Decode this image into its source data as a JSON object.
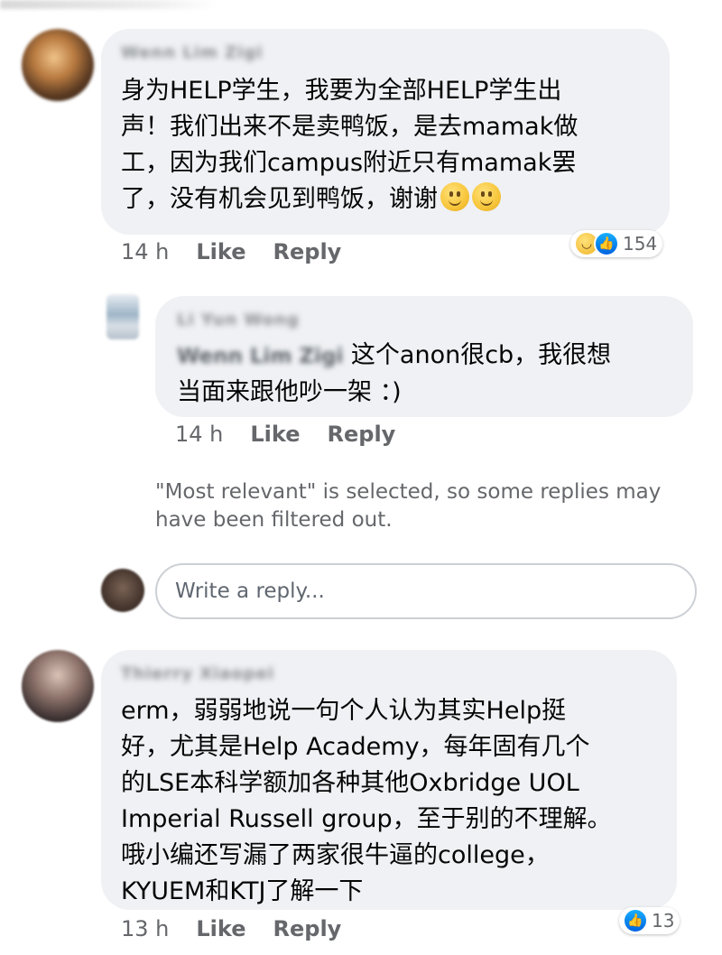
{
  "comments": [
    {
      "author": "Wenn Lim Zigi",
      "text": "身为HELP学生，我要为全部HELP学生出\n声！我们出来不是卖鸭饭，是去mamak做\n工，因为我们campus附近只有mamak罢\n了，没有机会见到鸭饭，谢谢",
      "emoji": [
        "slightly-smiling-face-icon",
        "slightly-smiling-face-icon"
      ],
      "time": "14 h",
      "like_label": "Like",
      "reply_label": "Reply",
      "reaction_icons": [
        "haha-reaction-icon",
        "like-reaction-icon"
      ],
      "reaction_count": "154"
    },
    {
      "author": "Li Yun Wong",
      "mention": "Wenn Lim Zigi",
      "text": " 这个anon很cb，我很想\n当面来跟他吵一架 ：)",
      "time": "14 h",
      "like_label": "Like",
      "reply_label": "Reply"
    },
    {
      "author": "Thierry Xiaopei",
      "text": "erm，弱弱地说一句个人认为其实Help挺\n好，尤其是Help Academy，每年固有几个\n的LSE本科学额加各种其他Oxbridge UOL\nImperial Russell group，至于别的不理解。\n哦小编还写漏了两家很牛逼的college，\nKYUEM和KTJ了解一下",
      "time": "13 h",
      "like_label": "Like",
      "reply_label": "Reply",
      "reaction_icons": [
        "like-reaction-icon"
      ],
      "reaction_count": "13"
    }
  ],
  "filtered_notice": "\"Most relevant\" is selected, so some replies may have been filtered out.",
  "reply_input": {
    "placeholder": "Write a reply..."
  },
  "colors": {
    "bubble": "#eff1f4",
    "meta_text": "#65676b",
    "like_blue": "#0062df",
    "haha_yellow": "#f0b428"
  }
}
